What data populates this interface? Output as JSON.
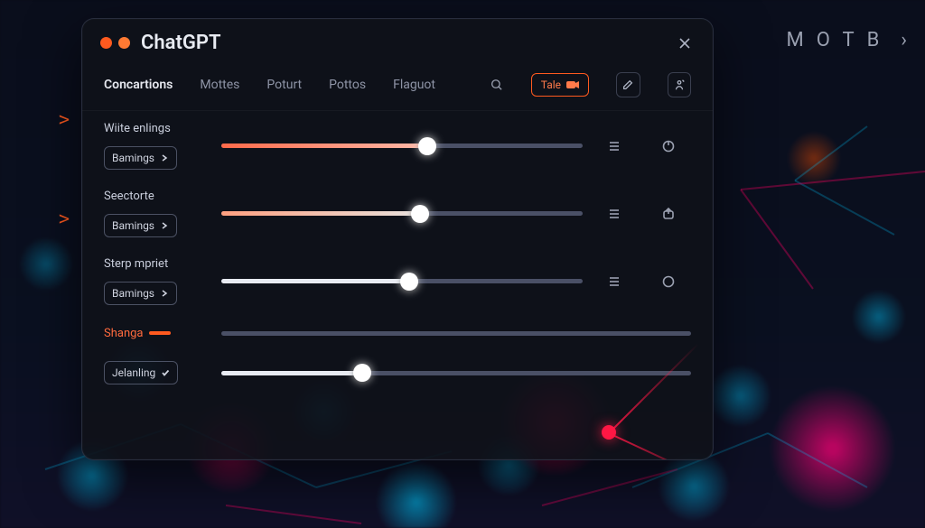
{
  "app": {
    "title": "ChatGPT"
  },
  "bg": {
    "top_text": "MOTB",
    "prompt1": ">",
    "prompt2": ">"
  },
  "tabs": {
    "items": [
      {
        "label": "Concartions",
        "active": true
      },
      {
        "label": "Mottes"
      },
      {
        "label": "Poturt"
      },
      {
        "label": "Pottos"
      },
      {
        "label": "Flaguot"
      }
    ],
    "chip_label": "Tale"
  },
  "rows": [
    {
      "label": "Wiite enlings",
      "dropdown": "Bamings",
      "slider": {
        "fill_pct": 57,
        "thumb_pct": 57,
        "fill_style": "grad-warm",
        "has_thumb": true
      },
      "icon_a": "menu",
      "icon_b": "power"
    },
    {
      "label": "Seectorte",
      "dropdown": "Bamings",
      "slider": {
        "fill_pct": 55,
        "thumb_pct": 55,
        "fill_style": "grad-light",
        "has_thumb": true
      },
      "icon_a": "menu",
      "icon_b": "export"
    },
    {
      "label": "Sterp mpriet",
      "dropdown": "Bamings",
      "slider": {
        "fill_pct": 52,
        "thumb_pct": 52,
        "fill_style": "fill-white",
        "has_thumb": true
      },
      "icon_a": "menu",
      "icon_b": "circle"
    }
  ],
  "shanga": {
    "label": "Shanga",
    "slider": {
      "fill_pct": 0,
      "thumb_pct": 0,
      "has_thumb": false
    }
  },
  "bottom": {
    "dropdown": "Jelanling",
    "slider": {
      "fill_pct": 30,
      "thumb_pct": 30,
      "fill_style": "fill-white",
      "has_thumb": true
    }
  },
  "colors": {
    "accent": "#ff5a1f",
    "track": "#4a5066"
  }
}
